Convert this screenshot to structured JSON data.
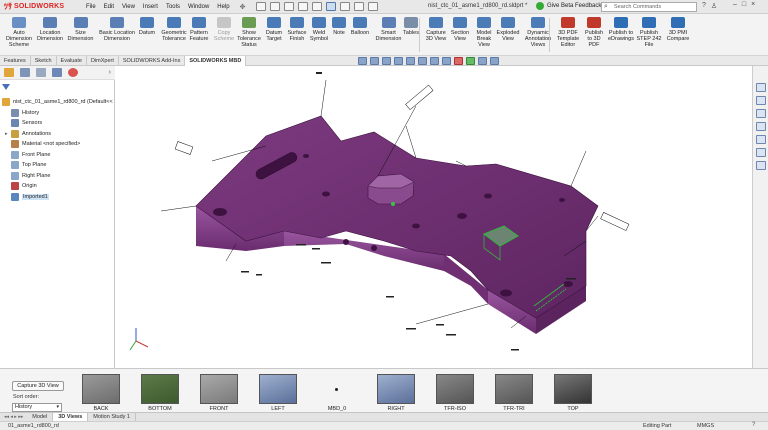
{
  "app": {
    "logo_text": "SOLIDWORKS",
    "doc_title": "nist_ctc_01_asme1_rd800_rd.sldprt *"
  },
  "menu": [
    "File",
    "Edit",
    "View",
    "Insert",
    "Tools",
    "Window",
    "Help"
  ],
  "titlebar": {
    "beta_feedback": "Give Beta Feedback",
    "search_placeholder": "Search Commands"
  },
  "ribbon": {
    "buttons": [
      {
        "label": "Auto\nDimension\nScheme",
        "icon": "auto-dimension-icon",
        "color": "#6a8fc4"
      },
      {
        "label": "Location\nDimension",
        "icon": "location-dimension-icon",
        "color": "#5b7fb5"
      },
      {
        "label": "Size\nDimension",
        "icon": "size-dimension-icon",
        "color": "#5b7fb5"
      },
      {
        "label": "Basic Location\nDimension",
        "icon": "basic-location-dimension-icon",
        "color": "#5b7fb5"
      },
      {
        "label": "Datum",
        "icon": "datum-icon",
        "color": "#4a7bb6"
      },
      {
        "label": "Geometric\nTolerance",
        "icon": "geometric-tolerance-icon",
        "color": "#4a7bb6"
      },
      {
        "label": "Pattern\nFeature",
        "icon": "pattern-feature-icon",
        "color": "#4a7bb6"
      },
      {
        "label": "Copy\nScheme",
        "icon": "copy-scheme-icon",
        "color": "#c6c6c6",
        "disabled": true
      },
      {
        "label": "Show\nTolerance\nStatus",
        "icon": "tolerance-status-icon",
        "color": "#6a9c54"
      },
      {
        "label": "Datum\nTarget",
        "icon": "datum-target-icon",
        "color": "#4a7bb6"
      },
      {
        "label": "Surface\nFinish",
        "icon": "surface-finish-icon",
        "color": "#4a7bb6"
      },
      {
        "label": "Weld\nSymbol",
        "icon": "weld-symbol-icon",
        "color": "#4a7bb6"
      },
      {
        "label": "Note",
        "icon": "note-icon",
        "color": "#4a7bb6"
      },
      {
        "label": "Balloon",
        "icon": "balloon-icon",
        "color": "#4a7bb6"
      },
      {
        "label": "Smart\nDimension",
        "icon": "smart-dimension-icon",
        "color": "#5b7fb5"
      },
      {
        "label": "Tables",
        "icon": "tables-icon",
        "color": "#7a8ea8"
      },
      {
        "label": "Capture\n3D View",
        "icon": "capture-3d-view-icon",
        "color": "#4c7cb8"
      },
      {
        "label": "Section\nView",
        "icon": "section-view-icon",
        "color": "#4c7cb8"
      },
      {
        "label": "Model\nBreak\nView",
        "icon": "model-break-view-icon",
        "color": "#4c7cb8"
      },
      {
        "label": "Exploded\nView",
        "icon": "exploded-view-icon",
        "color": "#4c7cb8"
      },
      {
        "label": "Dynamic\nAnnotation\nViews",
        "icon": "dynamic-annotation-views-icon",
        "color": "#4c7cb8"
      },
      {
        "label": "3D PDF\nTemplate\nEditor",
        "icon": "pdf-template-editor-icon",
        "color": "#c0392b"
      },
      {
        "label": "Publish\nto 3D\nPDF",
        "icon": "publish-3d-pdf-icon",
        "color": "#c0392b"
      },
      {
        "label": "Publish to\neDrawings",
        "icon": "publish-edrawings-icon",
        "color": "#2f6db5"
      },
      {
        "label": "Publish\nSTEP 242\nFile",
        "icon": "publish-step242-icon",
        "color": "#2f6db5"
      },
      {
        "label": "3D PMI\nCompare",
        "icon": "pmi-compare-icon",
        "color": "#2f6db5"
      }
    ]
  },
  "tabs": [
    "Features",
    "Sketch",
    "Evaluate",
    "DimXpert",
    "SOLIDWORKS Add-Ins",
    "SOLIDWORKS MBD"
  ],
  "active_tab": "SOLIDWORKS MBD",
  "tree": {
    "root": "nist_ctc_01_asme1_rd800_rd  (Default<<",
    "items": [
      {
        "label": "History",
        "icon": "history-icon",
        "color": "#7a8fb0"
      },
      {
        "label": "Sensors",
        "icon": "sensors-icon",
        "color": "#6b86b0"
      },
      {
        "label": "Annotations",
        "icon": "annotations-icon",
        "color": "#c8a040",
        "expandable": true
      },
      {
        "label": "Material <not specified>",
        "icon": "material-icon",
        "color": "#b5804a"
      },
      {
        "label": "Front Plane",
        "icon": "plane-icon",
        "color": "#8aa6c8"
      },
      {
        "label": "Top Plane",
        "icon": "plane-icon",
        "color": "#8aa6c8"
      },
      {
        "label": "Right Plane",
        "icon": "plane-icon",
        "color": "#8aa6c8"
      },
      {
        "label": "Origin",
        "icon": "origin-icon",
        "color": "#b44"
      },
      {
        "label": "Imported1",
        "icon": "imported-body-icon",
        "color": "#5a86c0",
        "selected": true
      }
    ]
  },
  "views_panel": {
    "capture_label": "Capture 3D View",
    "sort_label": "Sort order:",
    "sort_value": "History",
    "views": [
      {
        "label": "BACK",
        "icon": "view-back-icon"
      },
      {
        "label": "BOTTOM",
        "icon": "view-bottom-icon"
      },
      {
        "label": "FRONT",
        "icon": "view-front-icon"
      },
      {
        "label": "LEFT",
        "icon": "view-left-icon"
      },
      {
        "label": "MBD_0",
        "icon": "view-mbd0-icon"
      },
      {
        "label": "RIGHT",
        "icon": "view-right-icon"
      },
      {
        "label": "TFR-ISO",
        "icon": "view-tfr-iso-icon"
      },
      {
        "label": "TFR-TRI",
        "icon": "view-tfr-tri-icon"
      },
      {
        "label": "TOP",
        "icon": "view-top-icon"
      }
    ]
  },
  "model_tabs": [
    "Model",
    "3D Views",
    "Motion Study 1"
  ],
  "active_model_tab": "3D Views",
  "status": {
    "left": "01_asme1_rd800_rd",
    "editing": "Editing Part",
    "units": "MMGS"
  },
  "colors": {
    "part_purple": "#6b2d6e",
    "part_purple_light": "#8e4a91",
    "selection_green": "#38c24a",
    "accent_red": "#d22"
  }
}
